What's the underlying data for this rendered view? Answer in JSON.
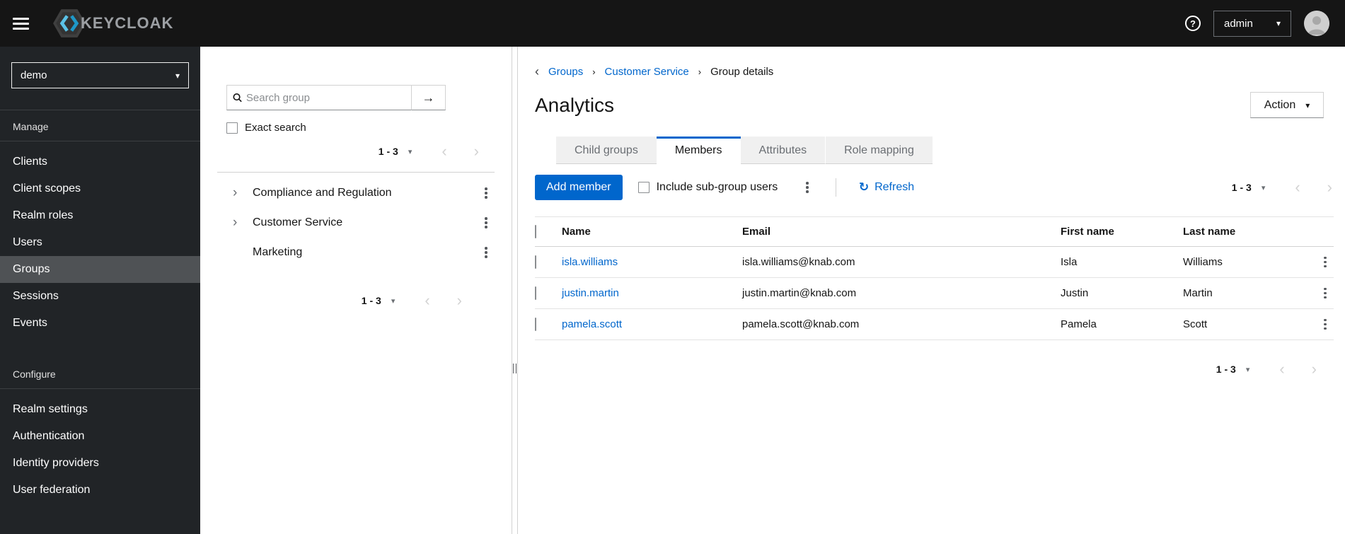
{
  "icons": {
    "caret_down": "▾",
    "chevron_right": "›",
    "chevron_left": "‹",
    "arrow_right": "→",
    "refresh": "↻",
    "help": "?"
  },
  "topbar": {
    "brand": "KEYCLOAK",
    "username": "admin"
  },
  "sidebar": {
    "realm": "demo",
    "manage": {
      "title": "Manage",
      "items": [
        "Clients",
        "Client scopes",
        "Realm roles",
        "Users",
        "Groups",
        "Sessions",
        "Events"
      ]
    },
    "configure": {
      "title": "Configure",
      "items": [
        "Realm settings",
        "Authentication",
        "Identity providers",
        "User federation"
      ]
    },
    "active_item": "Groups"
  },
  "tree": {
    "search_placeholder": "Search group",
    "exact_search": "Exact search",
    "pagination": {
      "range": "1 - 3"
    },
    "items": [
      {
        "label": "Compliance and Regulation",
        "expandable": true
      },
      {
        "label": "Customer Service",
        "expandable": true
      },
      {
        "label": "Marketing",
        "expandable": false
      }
    ]
  },
  "main": {
    "breadcrumb": {
      "items": [
        "Groups",
        "Customer Service",
        "Group details"
      ]
    },
    "title": "Analytics",
    "action": "Action",
    "tabs": [
      "Child groups",
      "Members",
      "Attributes",
      "Role mapping"
    ],
    "active_tab": "Members",
    "toolbar": {
      "add_member": "Add member",
      "include_subgroups": "Include sub-group users",
      "refresh": "Refresh",
      "pagination": {
        "range": "1 - 3"
      }
    },
    "table": {
      "headers": [
        "Name",
        "Email",
        "First name",
        "Last name"
      ],
      "rows": [
        {
          "name": "isla.williams",
          "email": "isla.williams@knab.com",
          "first_name": "Isla",
          "last_name": "Williams"
        },
        {
          "name": "justin.martin",
          "email": "justin.martin@knab.com",
          "first_name": "Justin",
          "last_name": "Martin"
        },
        {
          "name": "pamela.scott",
          "email": "pamela.scott@knab.com",
          "first_name": "Pamela",
          "last_name": "Scott"
        }
      ]
    },
    "bottom_pagination": {
      "range": "1 - 3"
    }
  },
  "colors": {
    "primary": "#0066cc",
    "link": "#0066cc",
    "masthead_bg": "#151515",
    "sidebar_bg": "#212427",
    "sidebar_active_bg": "#4f5255",
    "tab_inactive_bg": "#f0f0f0"
  }
}
